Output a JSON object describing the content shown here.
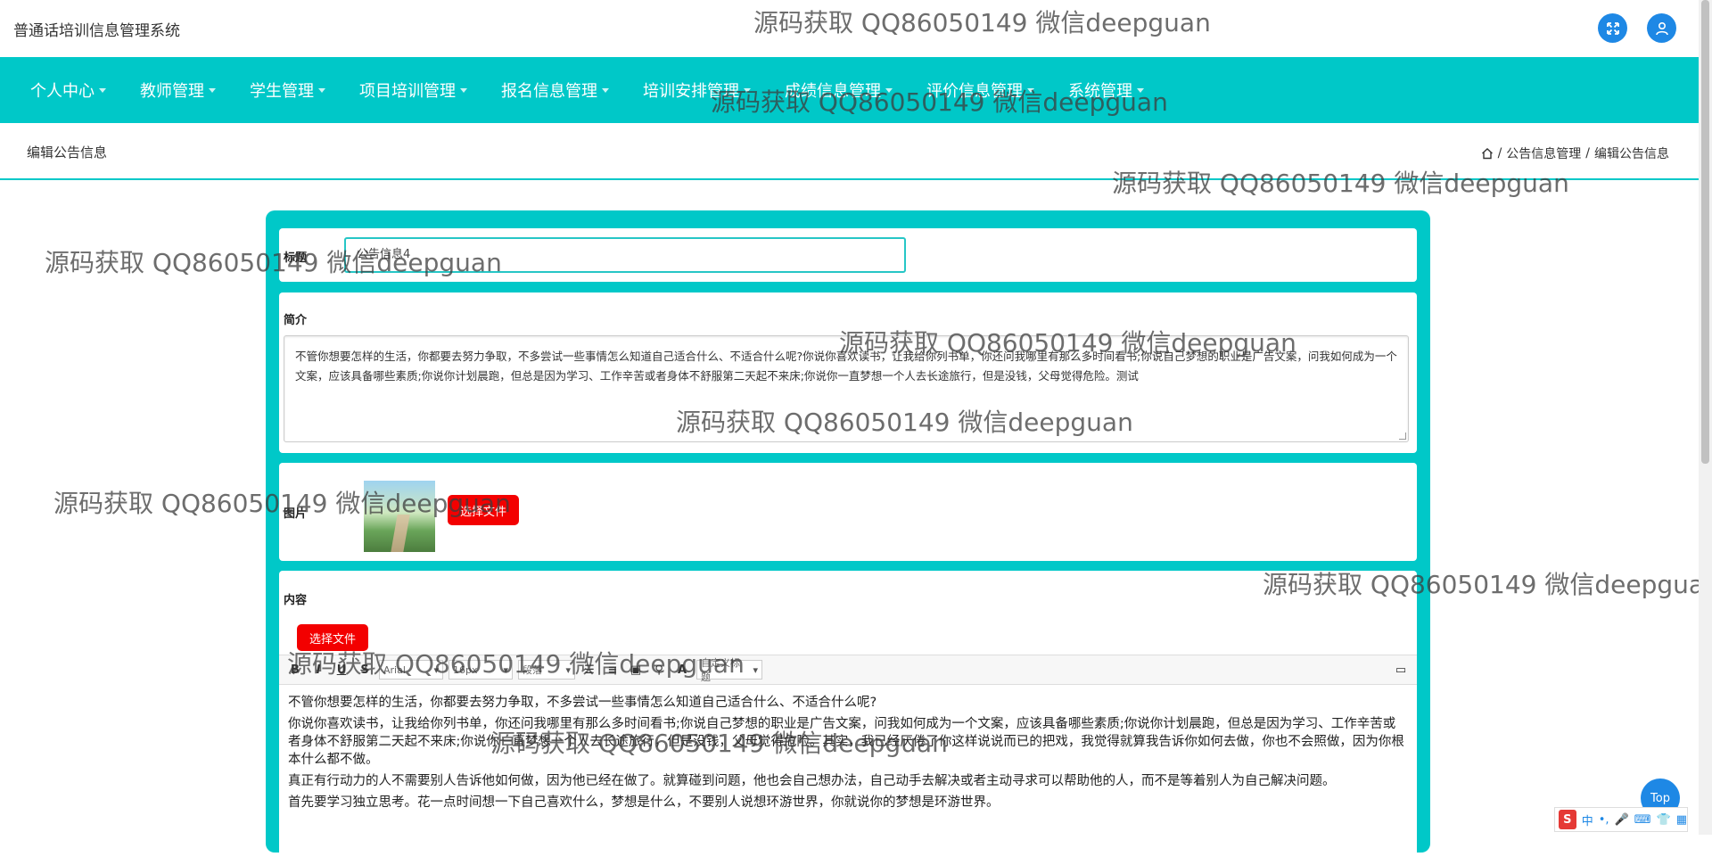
{
  "app": {
    "title": "普通话培训信息管理系统"
  },
  "header": {
    "fullscreen_icon": "expand-icon",
    "user_icon": "user-icon"
  },
  "nav": [
    {
      "label": "个人中心"
    },
    {
      "label": "教师管理"
    },
    {
      "label": "学生管理"
    },
    {
      "label": "项目培训管理"
    },
    {
      "label": "报名信息管理"
    },
    {
      "label": "培训安排管理"
    },
    {
      "label": "成绩信息管理"
    },
    {
      "label": "评价信息管理"
    },
    {
      "label": "系统管理"
    }
  ],
  "page": {
    "title": "编辑公告信息",
    "breadcrumb": {
      "home_icon": "home-icon",
      "sep": "/",
      "level1": "公告信息管理",
      "level2": "编辑公告信息"
    }
  },
  "form": {
    "title_label": "标题",
    "title_value": "公告信息4",
    "intro_label": "简介",
    "intro_value": "不管你想要怎样的生活，你都要去努力争取，不多尝试一些事情怎么知道自己适合什么、不适合什么呢?你说你喜欢读书，让我给你列书单，你还问我哪里有那么多时间看书;你说自己梦想的职业是广告文案，问我如何成为一个文案，应该具备哪些素质;你说你计划晨跑，但总是因为学习、工作辛苦或者身体不舒服第二天起不来床;你说你一直梦想一个人去长途旅行，但是没钱，父母觉得危险。测试",
    "image_label": "图片",
    "image_button": "选择文件",
    "content_label": "内容",
    "content_button": "选择文件",
    "toolbar": {
      "font": "Arial",
      "size": "16px",
      "format": "段落",
      "custom": "自定义标题"
    },
    "content_paragraphs": [
      "不管你想要怎样的生活，你都要去努力争取，不多尝试一些事情怎么知道自己适合什么、不适合什么呢?",
      "你说你喜欢读书，让我给你列书单，你还问我哪里有那么多时间看书;你说自己梦想的职业是广告文案，问我如何成为一个文案，应该具备哪些素质;你说你计划晨跑，但总是因为学习、工作辛苦或者身体不舒服第二天起不来床;你说你一直梦想一个人去长途旅行，但是没钱，父母觉得危险。其实，我已经厌倦了你这样说说而已的把戏，我觉得就算我告诉你如何去做，你也不会照做，因为你根本什么都不做。",
      "真正有行动力的人不需要别人告诉他如何做，因为他已经在做了。就算碰到问题，他也会自己想办法，自己动手去解决或者主动寻求可以帮助他的人，而不是等着别人为自己解决问题。",
      "首先要学习独立思考。花一点时间想一下自己喜欢什么，梦想是什么，不要别人说想环游世界，你就说你的梦想是环游世界。"
    ]
  },
  "watermark": "源码获取 QQ86050149 微信deepguan",
  "back_to_top": "Top",
  "ime": {
    "logo": "S",
    "lang": "中"
  }
}
